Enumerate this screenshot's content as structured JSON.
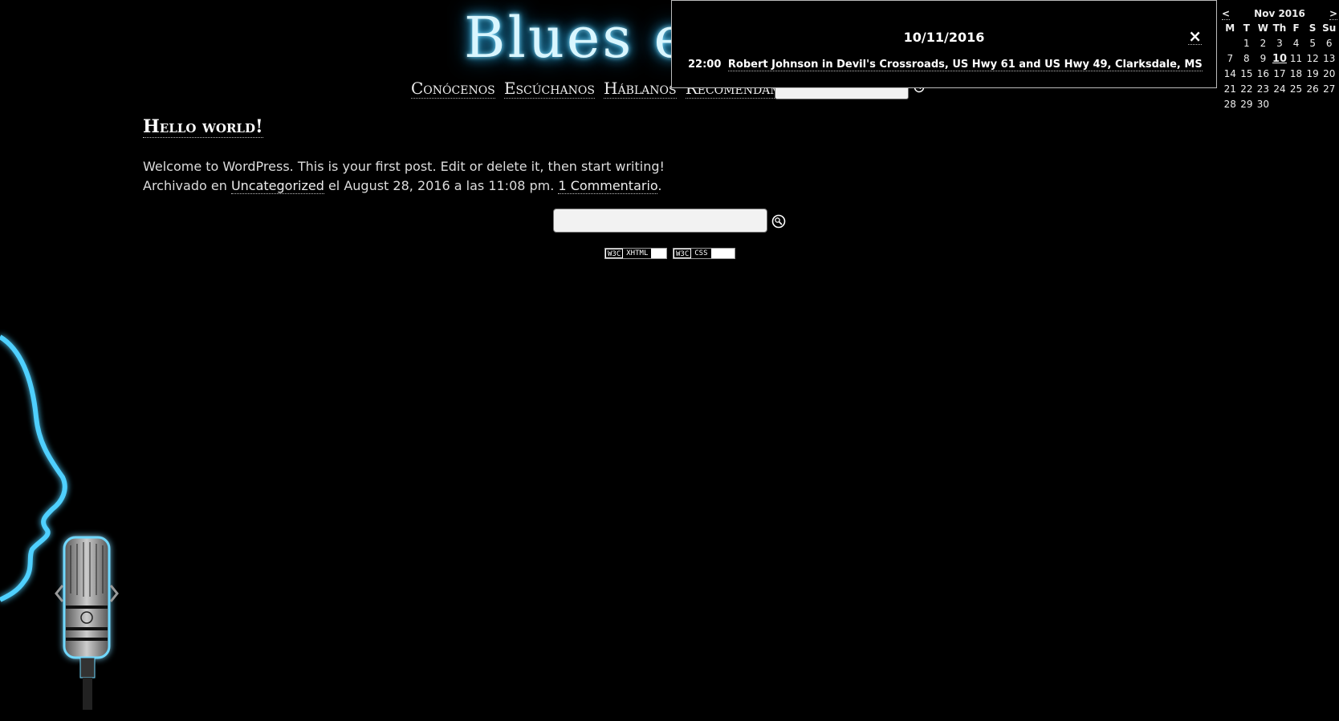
{
  "header": {
    "logo_text": "Blues en"
  },
  "nav": {
    "items": [
      {
        "label": "Conócenos"
      },
      {
        "label": "Escúchanos"
      },
      {
        "label": "Háblanos"
      },
      {
        "label": "Recomendamos"
      }
    ]
  },
  "post": {
    "title": "Hello world!",
    "body": "Welcome to WordPress. This is your first post. Edit or delete it, then start writing!",
    "meta_prefix": "Archivado en ",
    "category": "Uncategorized",
    "meta_middle": " el August 28, 2016 a las 11:08 pm. ",
    "comments": "1 Commentario",
    "meta_suffix": "."
  },
  "badges": {
    "w3c": "W3C",
    "xhtml": "XHTML",
    "css": "CSS"
  },
  "popup": {
    "date": "10/11/2016",
    "close": "×",
    "event_time": "22:00",
    "event_title": "Robert Johnson in Devil's Crossroads, US Hwy 61 and US Hwy 49, Clarksdale, MS"
  },
  "calendar": {
    "prev": "<",
    "next": ">",
    "month": "Nov 2016",
    "dow": [
      "M",
      "T",
      "W",
      "Th",
      "F",
      "S",
      "Su"
    ],
    "weeks": [
      [
        "",
        "1",
        "2",
        "3",
        "4",
        "5",
        "6"
      ],
      [
        "7",
        "8",
        "9",
        "10",
        "11",
        "12",
        "13"
      ],
      [
        "14",
        "15",
        "16",
        "17",
        "18",
        "19",
        "20"
      ],
      [
        "21",
        "22",
        "23",
        "24",
        "25",
        "26",
        "27"
      ],
      [
        "28",
        "29",
        "30",
        "",
        "",
        "",
        ""
      ]
    ],
    "today": "10"
  },
  "colors": {
    "background": "#000000",
    "glow": "#2fb8ee"
  }
}
